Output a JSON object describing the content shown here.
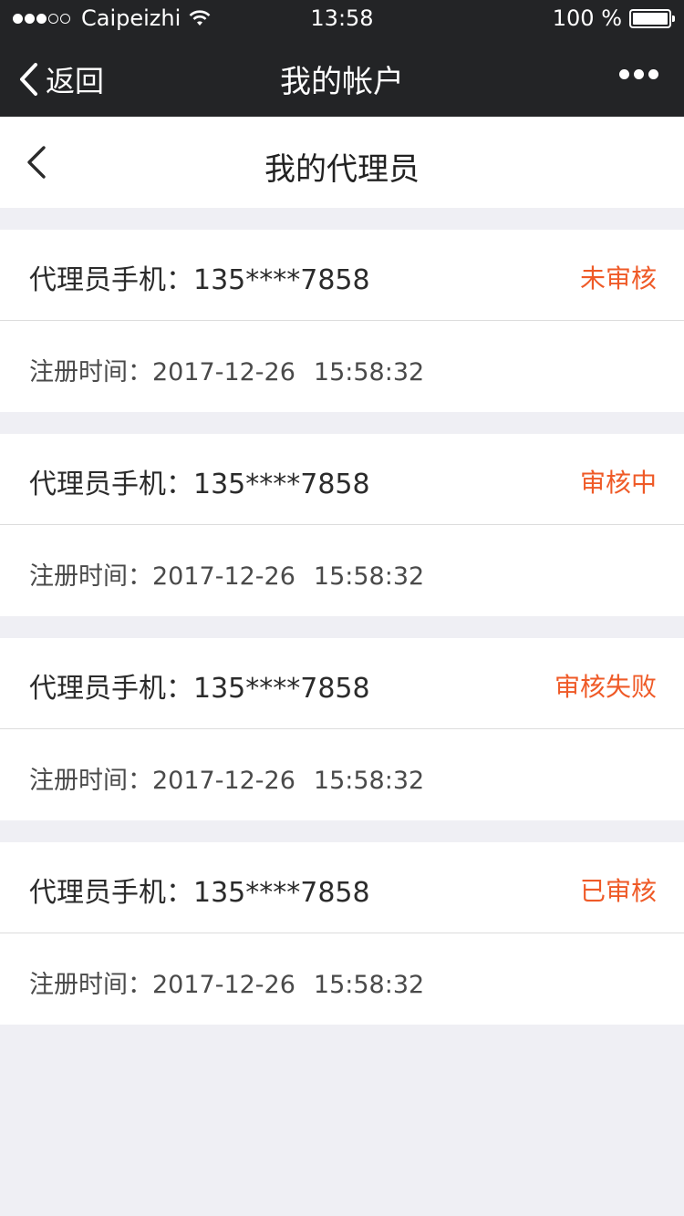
{
  "status_bar": {
    "carrier": "Caipeizhi",
    "time": "13:58",
    "battery": "100 %",
    "signal_bars_filled": 3,
    "signal_bars_total": 5
  },
  "wechat_nav": {
    "back_label": "返回",
    "title": "我的帐户"
  },
  "page": {
    "title": "我的代理员"
  },
  "colors": {
    "status_text": "#ef5a27",
    "nav_bg": "#232426",
    "page_bg": "#efeff4"
  },
  "agents": [
    {
      "phone_label": "代理员手机：",
      "phone": "135****7858",
      "status": "未审核",
      "time_label": "注册时间：",
      "date": "2017-12-26",
      "time": "15:58:32"
    },
    {
      "phone_label": "代理员手机：",
      "phone": "135****7858",
      "status": "审核中",
      "time_label": "注册时间：",
      "date": "2017-12-26",
      "time": "15:58:32"
    },
    {
      "phone_label": "代理员手机：",
      "phone": "135****7858",
      "status": "审核失败",
      "time_label": "注册时间：",
      "date": "2017-12-26",
      "time": "15:58:32"
    },
    {
      "phone_label": "代理员手机：",
      "phone": "135****7858",
      "status": "已审核",
      "time_label": "注册时间：",
      "date": "2017-12-26",
      "time": "15:58:32"
    }
  ]
}
